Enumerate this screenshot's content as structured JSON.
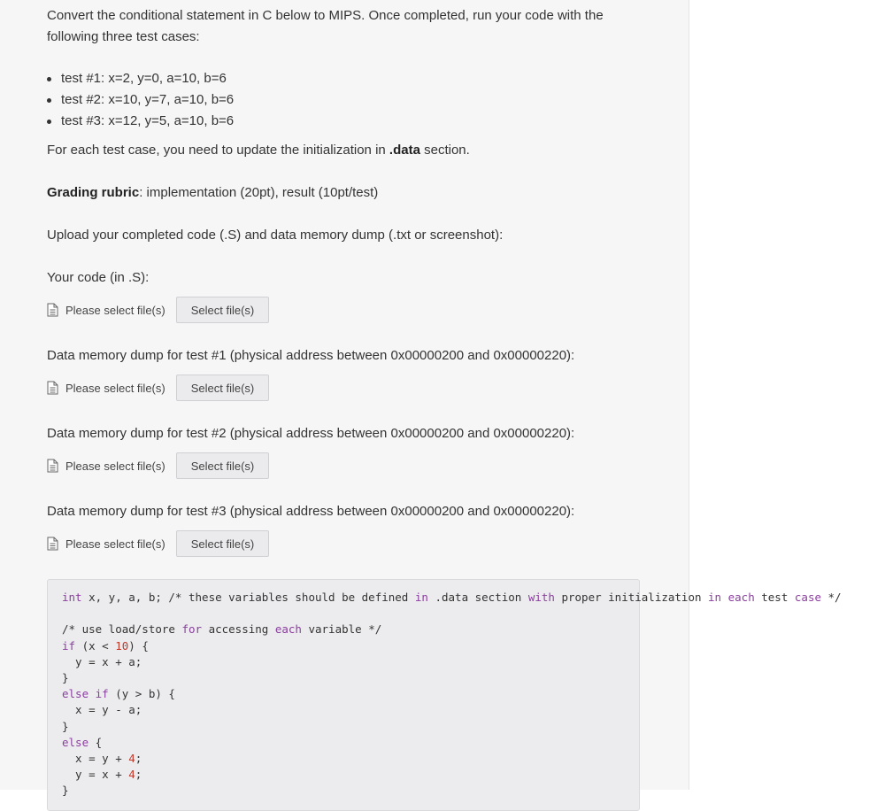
{
  "intro": "Convert the conditional statement in C below to MIPS. Once completed, run your code with the following three test cases:",
  "tests": [
    "test #1: x=2, y=0, a=10, b=6",
    "test #2: x=10, y=7, a=10, b=6",
    "test #3: x=12, y=5, a=10, b=6"
  ],
  "update_note": {
    "before": "For each test case, you need to update the initialization in ",
    "bold": ".data",
    "after": " section."
  },
  "rubric": {
    "label": "Grading rubric",
    "text": ": implementation (20pt), result (10pt/test)"
  },
  "upload_instruction": "Upload your completed code (.S) and data memory dump (.txt or screenshot):",
  "uploads": [
    {
      "label": "Your code (in .S):",
      "placeholder": "Please select file(s)",
      "button": "Select file(s)"
    },
    {
      "label": "Data memory dump for test #1 (physical address between 0x00000200 and 0x00000220):",
      "placeholder": "Please select file(s)",
      "button": "Select file(s)"
    },
    {
      "label": "Data memory dump for test #2 (physical address between 0x00000200 and 0x00000220):",
      "placeholder": "Please select file(s)",
      "button": "Select file(s)"
    },
    {
      "label": "Data memory dump for test #3 (physical address between 0x00000200 and 0x00000220):",
      "placeholder": "Please select file(s)",
      "button": "Select file(s)"
    }
  ],
  "code": {
    "line1": {
      "kw1": "int",
      "p1": " x, y, a, b; /* these variables should be defined ",
      "kw2": "in",
      "p2": " .data section ",
      "kw3": "with",
      "p3": " proper initialization ",
      "kw4": "in",
      "p4": " ",
      "kw5": "each",
      "p5": " test ",
      "kw6": "case",
      "p6": " */"
    },
    "comment2": {
      "p1": "/* use load/store ",
      "kw1": "for",
      "p2": " accessing ",
      "kw2": "each",
      "p3": " variable */"
    },
    "if_kw": "if",
    "if_cond_a": " (x < ",
    "if_num": "10",
    "if_cond_b": ") {",
    "stmt1": "  y = x + a;",
    "close": "}",
    "elseif_kw1": "else",
    "elseif_kw2": "if",
    "elseif_cond": " (y > b) {",
    "stmt2": "  x = y - a;",
    "else_kw": "else",
    "else_brace": " {",
    "stmt3a": "  x = y + ",
    "num4a": "4",
    "semi": ";",
    "stmt4a": "  y = x + ",
    "num4b": "4",
    "close_partial": "}"
  },
  "colors": {
    "panel_bg": "#f6f6f7",
    "keyword": "#8a3e9e",
    "number": "#c0392b"
  }
}
